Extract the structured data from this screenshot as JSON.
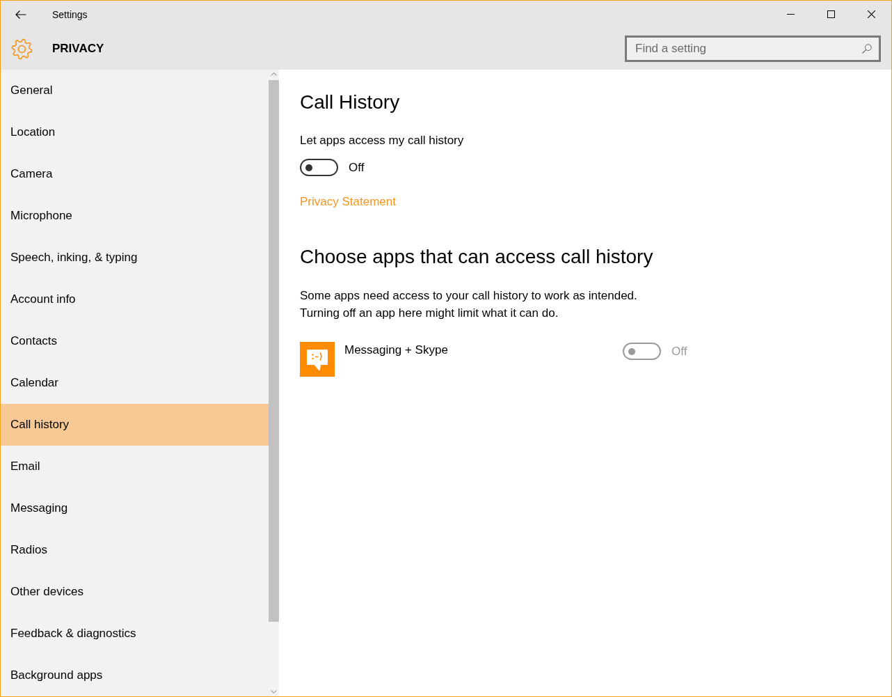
{
  "window": {
    "title": "Settings"
  },
  "header": {
    "title": "PRIVACY",
    "search": {
      "placeholder": "Find a setting"
    }
  },
  "sidebar": {
    "items": [
      {
        "label": "General",
        "selected": false
      },
      {
        "label": "Location",
        "selected": false
      },
      {
        "label": "Camera",
        "selected": false
      },
      {
        "label": "Microphone",
        "selected": false
      },
      {
        "label": "Speech, inking, & typing",
        "selected": false
      },
      {
        "label": "Account info",
        "selected": false
      },
      {
        "label": "Contacts",
        "selected": false
      },
      {
        "label": "Calendar",
        "selected": false
      },
      {
        "label": "Call history",
        "selected": true
      },
      {
        "label": "Email",
        "selected": false
      },
      {
        "label": "Messaging",
        "selected": false
      },
      {
        "label": "Radios",
        "selected": false
      },
      {
        "label": "Other devices",
        "selected": false
      },
      {
        "label": "Feedback & diagnostics",
        "selected": false
      },
      {
        "label": "Background apps",
        "selected": false
      }
    ]
  },
  "content": {
    "title": "Call History",
    "setting": {
      "label": "Let apps access my call history",
      "on": false,
      "state_text": "Off"
    },
    "link": "Privacy Statement",
    "section_title": "Choose apps that can access call history",
    "description": "Some apps need access to your call history to work as intended.\nTurning off an app here might limit what it can do.",
    "apps": [
      {
        "name": "Messaging + Skype",
        "on": false,
        "disabled": true,
        "state_text": "Off"
      }
    ]
  }
}
